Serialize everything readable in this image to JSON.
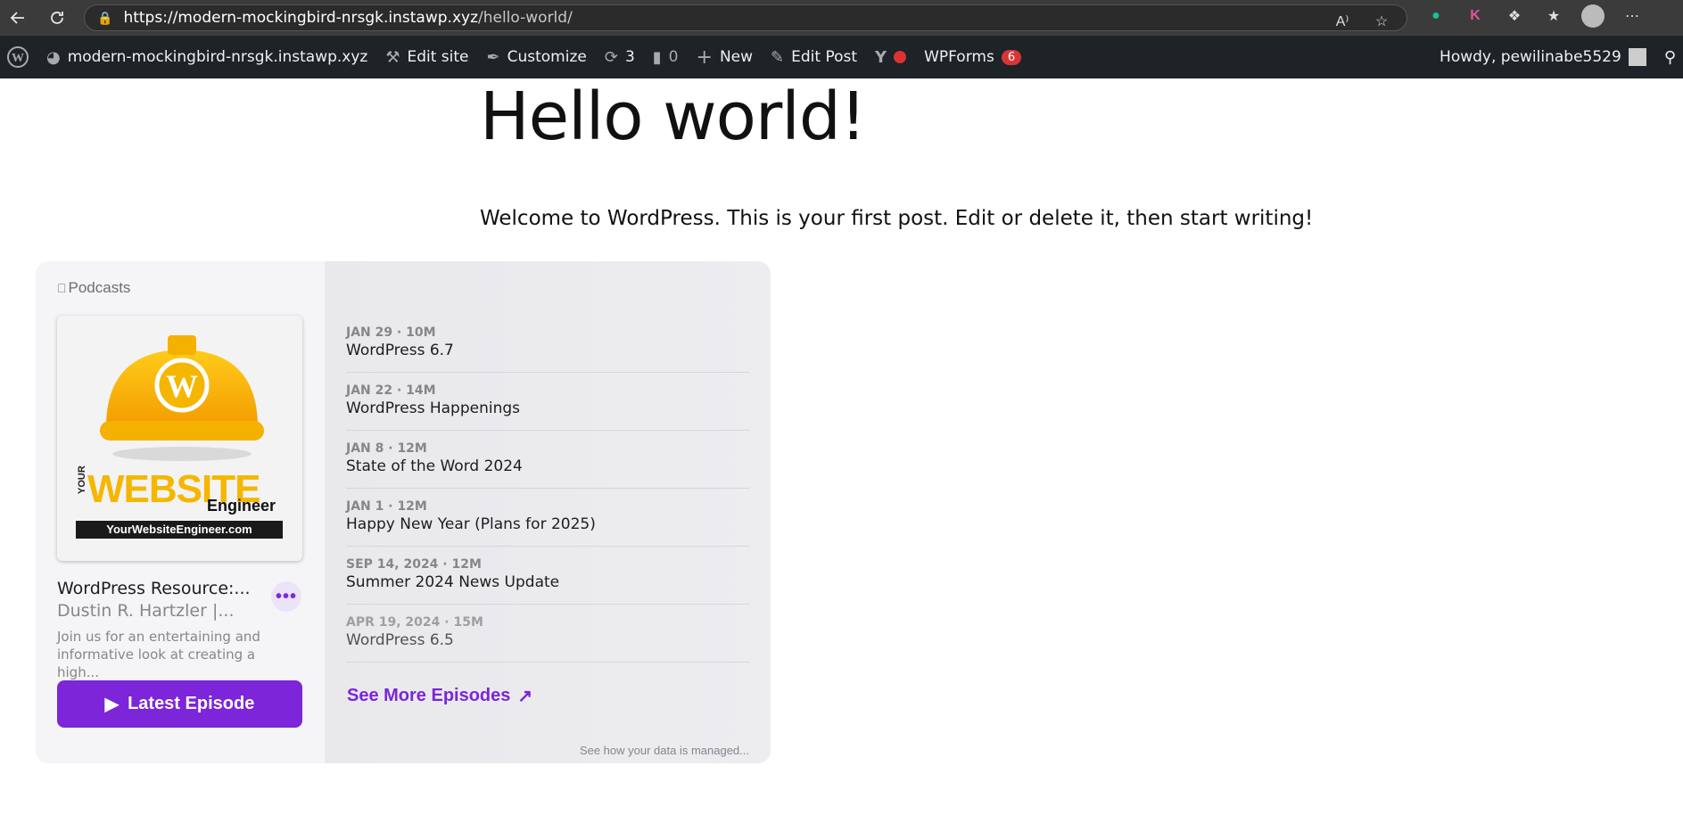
{
  "browser": {
    "url_host": "https://modern-mockingbird-nrsgk.instawp.xyz",
    "url_path": "/hello-world/"
  },
  "admin_bar": {
    "site_name": "modern-mockingbird-nrsgk.instawp.xyz",
    "edit_site": "Edit site",
    "customize": "Customize",
    "updates_count": "3",
    "comments_count": "0",
    "new_label": "New",
    "edit_post": "Edit Post",
    "wpforms": "WPForms",
    "wpforms_badge": "6",
    "howdy": "Howdy, pewilinabe5529"
  },
  "post": {
    "title": "Hello world!",
    "body": "Welcome to WordPress. This is your first post. Edit or delete it, then start writing!"
  },
  "podcast": {
    "brand": "Podcasts",
    "artwork": {
      "your": "YOUR",
      "website": "WEBSITE",
      "engineer": "Engineer",
      "url": "YourWebsiteEngineer.com"
    },
    "show_title": "WordPress Resource:...",
    "author": "Dustin R. Hartzler |...",
    "description": "Join us for an entertaining and informative look at creating a high...",
    "latest_button": "Latest Episode",
    "episodes": [
      {
        "meta": "JAN 29 · 10M",
        "title": "WordPress 6.7"
      },
      {
        "meta": "JAN 22 · 14M",
        "title": "WordPress Happenings"
      },
      {
        "meta": "JAN 8 · 12M",
        "title": "State of the Word 2024"
      },
      {
        "meta": "JAN 1 · 12M",
        "title": "Happy New Year (Plans for 2025)"
      },
      {
        "meta": "SEP 14, 2024 · 12M",
        "title": "Summer 2024 News Update"
      },
      {
        "meta": "APR 19, 2024 · 15M",
        "title": "WordPress 6.5"
      }
    ],
    "see_more": "See More Episodes",
    "data_note": "See how your data is managed...",
    "accent_color": "#7c25d9"
  }
}
